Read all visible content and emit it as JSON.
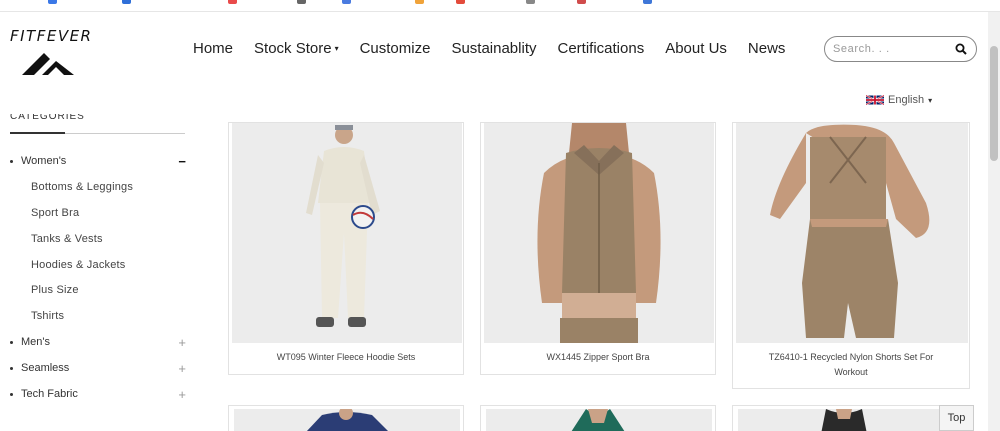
{
  "brand": {
    "name": "FITFEVER"
  },
  "nav": {
    "items": [
      {
        "label": "Home"
      },
      {
        "label": "Stock Store",
        "has_dropdown": true
      },
      {
        "label": "Customize"
      },
      {
        "label": "Sustainablity"
      },
      {
        "label": "Certifications"
      },
      {
        "label": "About Us"
      },
      {
        "label": "News"
      }
    ],
    "caret": "▾"
  },
  "search": {
    "placeholder": "Search. . ."
  },
  "language": {
    "label": "English",
    "caret": "▾"
  },
  "sidebar": {
    "title": "CATEGORIES",
    "categories": [
      {
        "label": "Women's",
        "toggle": "−",
        "expanded": true,
        "subitems": [
          "Bottoms & Leggings",
          "Sport Bra",
          "Tanks & Vests",
          "Hoodies & Jackets",
          "Plus Size",
          "Tshirts"
        ]
      },
      {
        "label": "Men's",
        "toggle": "+"
      },
      {
        "label": "Seamless",
        "toggle": "+"
      },
      {
        "label": "Tech Fabric",
        "toggle": "+"
      }
    ]
  },
  "products": [
    {
      "name": "WT095 Winter Fleece Hoodie Sets"
    },
    {
      "name": "WX1445 Zipper Sport Bra"
    },
    {
      "name": "TZ6410-1 Recycled Nylon Shorts Set For Workout"
    },
    {
      "name": ""
    },
    {
      "name": ""
    },
    {
      "name": ""
    }
  ],
  "top_button": {
    "label": "Top"
  },
  "colors": {
    "sand": "#a68a6d",
    "cream": "#e9e6dc",
    "navy": "#2b3d75",
    "teal": "#1f6b5a"
  }
}
